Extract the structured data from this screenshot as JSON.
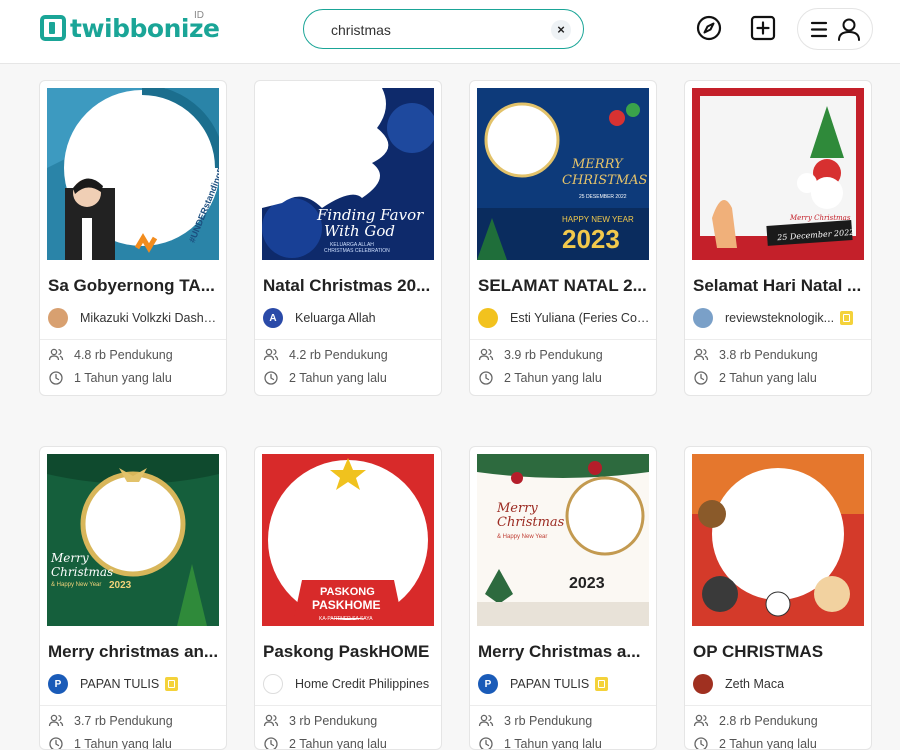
{
  "header": {
    "logo_text": "twibbonize",
    "logo_region": "ID",
    "search": {
      "value": "christmas"
    },
    "clear_label": "×"
  },
  "campaigns": [
    {
      "title": "Sa Gobyernong TA...",
      "author": "Mikazuki Volkzki Dashw...",
      "verified": false,
      "supporters": "4.8 rb Pendukung",
      "time": "1 Tahun yang lalu",
      "thumb_text": [
        "#UNDERstandingPartyList"
      ]
    },
    {
      "title": "Natal Christmas 20...",
      "author": "Keluarga Allah",
      "verified": false,
      "supporters": "4.2 rb Pendukung",
      "time": "2 Tahun yang lalu",
      "thumb_text": [
        "Finding Favor",
        "With God",
        "KELUARGA ALLAH",
        "CHRISTMAS CELEBRATION"
      ]
    },
    {
      "title": "SELAMAT NATAL 2...",
      "author": "Esti Yuliana (Feries Cor...",
      "verified": false,
      "supporters": "3.9 rb Pendukung",
      "time": "2 Tahun yang lalu",
      "thumb_text": [
        "MERRY",
        "CHRISTMAS",
        "25 DESEMBER 2022",
        "HAPPY NEW YEAR",
        "2023"
      ]
    },
    {
      "title": "Selamat Hari Natal ...",
      "author": "reviewsteknologik...",
      "verified": true,
      "supporters": "3.8 rb Pendukung",
      "time": "2 Tahun yang lalu",
      "thumb_text": [
        "Merry Christmas",
        "25 December 2022"
      ]
    },
    {
      "title": "Merry christmas an...",
      "author": "PAPAN TULIS",
      "verified": true,
      "supporters": "3.7 rb Pendukung",
      "time": "1 Tahun yang lalu",
      "thumb_text": [
        "Merry",
        "Christmas",
        "& Happy New Year",
        "2023"
      ]
    },
    {
      "title": "Paskong PaskHOME",
      "author": "Home Credit Philippines",
      "verified": false,
      "supporters": "3 rb Pendukung",
      "time": "2 Tahun yang lalu",
      "thumb_text": [
        "PASKONG",
        "PASKHOME",
        "KA-PARTNER SA SAYA"
      ]
    },
    {
      "title": "Merry Christmas a...",
      "author": "PAPAN TULIS",
      "verified": true,
      "supporters": "3 rb Pendukung",
      "time": "1 Tahun yang lalu",
      "thumb_text": [
        "Merry",
        "Christmas",
        "& Happy New Year",
        "2023"
      ]
    },
    {
      "title": "OP CHRISTMAS",
      "author": "Zeth Maca",
      "verified": false,
      "supporters": "2.8 rb Pendukung",
      "time": "2 Tahun yang lalu",
      "thumb_text": []
    }
  ]
}
